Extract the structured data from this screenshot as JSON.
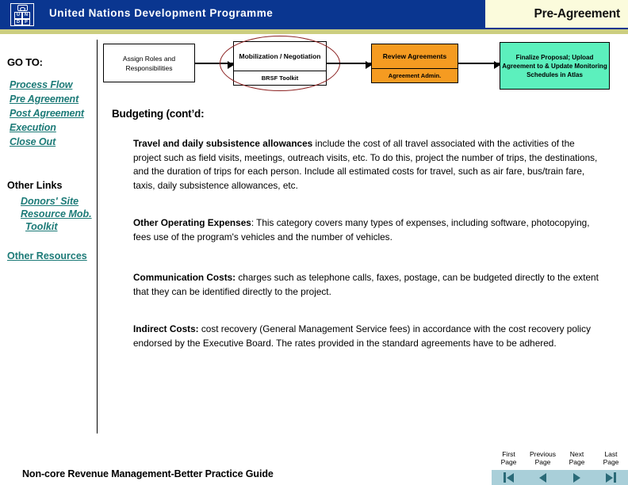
{
  "header": {
    "org_name": "United Nations Development Programme",
    "page_title": "Pre-Agreement",
    "logo_letters": [
      "U",
      "N",
      "D",
      "P"
    ],
    "blue": "#0a3690",
    "cream": "#fbfbdc",
    "rule_color": "#ccce80"
  },
  "sidebar": {
    "goto_label": "GO TO:",
    "links": [
      {
        "label": "Process Flow"
      },
      {
        "label": "Pre Agreement"
      },
      {
        "label": "Post Agreement"
      },
      {
        "label": "Execution"
      },
      {
        "label": "Close Out"
      }
    ],
    "other_links_label": "Other Links",
    "sub_links": [
      {
        "label": "Donors' Site"
      },
      {
        "label": "Resource Mob."
      },
      {
        "label": "Toolkit"
      }
    ],
    "other_resources": "Other Resources",
    "link_color": "#1c7a77"
  },
  "flow": {
    "boxes": [
      {
        "id": "assign",
        "title": "Assign Roles and Responsibilities",
        "subtitle": "",
        "fill": "#ffffff"
      },
      {
        "id": "mobilization",
        "title": "Mobilization / Negotiation",
        "subtitle": "BRSF Toolkit",
        "fill": "#ffffff",
        "highlighted": true
      },
      {
        "id": "review",
        "title": "Review Agreements",
        "subtitle": "Agreement Admin.",
        "fill": "#f59b21"
      },
      {
        "id": "finalize",
        "title": "Finalize Proposal; Upload Agreement to & Update Monitoring Schedules in Atlas",
        "subtitle": "",
        "fill": "#5cf0bd"
      }
    ],
    "highlight_color": "#8c2222"
  },
  "content": {
    "heading": "Budgeting (cont’d:",
    "paragraphs": [
      {
        "id": "travel",
        "lead": "Travel and daily subsistence allowances",
        "body": " include the cost of all travel associated with the activities of the project such as field visits, meetings, outreach visits, etc.  To do this, project the number of trips, the destinations, and the duration of trips for each person.  Include all estimated costs for travel, such as air fare, bus/train fare, taxis, daily subsistence allowances, etc."
      },
      {
        "id": "other",
        "lead": "Other Operating Expenses",
        "body": ":  This category covers many types of expenses, including software, photocopying, fees use of the program's vehicles and the number of vehicles."
      },
      {
        "id": "comm",
        "lead": "Communication Costs:",
        "body": "  charges such as telephone calls, faxes, postage, can be budgeted directly to the extent that they can be identified directly to the project."
      },
      {
        "id": "indirect",
        "lead": "Indirect Costs:",
        "body": "  cost recovery (General Management Service fees) in accordance with the cost recovery policy endorsed by the Executive Board. The rates provided in the standard agreements have to be adhered."
      }
    ]
  },
  "footer": {
    "document_title": "Non-core Revenue Management-Better Practice Guide",
    "pager": {
      "bar_color": "#a9cfd9",
      "arrow_color": "#2a6a78",
      "buttons": [
        {
          "label": "First\nPage",
          "icon": "first-page-icon"
        },
        {
          "label": "Previous\nPage",
          "icon": "previous-page-icon"
        },
        {
          "label": "Next\nPage",
          "icon": "next-page-icon"
        },
        {
          "label": "Last\nPage",
          "icon": "last-page-icon"
        }
      ]
    }
  }
}
